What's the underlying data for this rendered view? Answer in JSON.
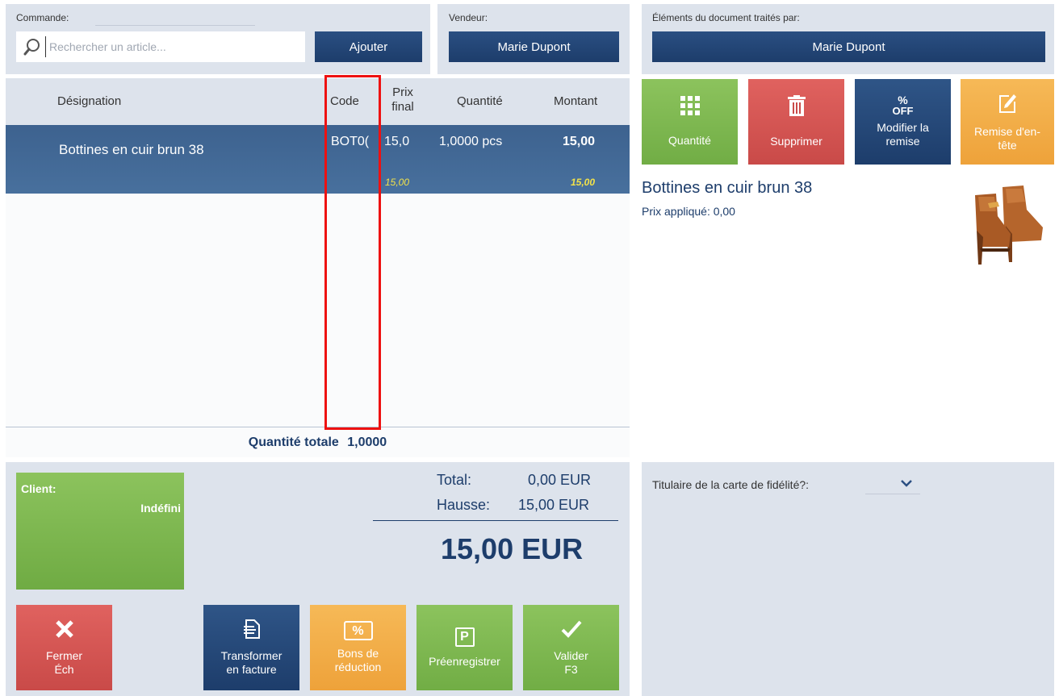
{
  "order": {
    "label": "Commande:",
    "search_placeholder": "Rechercher un article...",
    "add_label": "Ajouter"
  },
  "seller": {
    "label": "Vendeur:",
    "name": "Marie Dupont"
  },
  "processed_by": {
    "label": "Éléments du document traités par:",
    "name": "Marie Dupont"
  },
  "grid": {
    "columns": {
      "designation": "Désignation",
      "code": "Code",
      "price_line1": "Prix",
      "price_line2": "final",
      "quantity": "Quantité",
      "amount": "Montant"
    },
    "rows": [
      {
        "designation": "Bottines en cuir brun 38",
        "code": "BOT0(",
        "price": "15,0",
        "quantity": "1,0000 pcs",
        "amount": "15,00",
        "sub_price": "15,00",
        "sub_amount": "15,00"
      }
    ],
    "total_quantity_label": "Quantité totale",
    "total_quantity_value": "1,0000"
  },
  "actions": {
    "quantity": "Quantité",
    "delete": "Supprimer",
    "discount_icon_pct": "%",
    "discount_icon_off": "OFF",
    "discount_line1": "Modifier la",
    "discount_line2": "remise",
    "header_discount_line1": "Remise d'en-",
    "header_discount_line2": "tête"
  },
  "product": {
    "name": "Bottines en cuir brun 38",
    "price_label": "Prix appliqué: 0,00"
  },
  "client": {
    "label": "Client:",
    "value": "Indéfini"
  },
  "totals": {
    "total_label": "Total:",
    "total_value": "0,00 EUR",
    "surcharge_label": "Hausse:",
    "surcharge_value": "15,00 EUR",
    "grand_total": "15,00 EUR"
  },
  "loyalty": {
    "label": "Titulaire de la carte de fidélité?:"
  },
  "bottom_buttons": {
    "close_line1": "Fermer",
    "close_line2": "Éch",
    "invoice_line1": "Transformer",
    "invoice_line2": "en facture",
    "vouchers_line1": "Bons de",
    "vouchers_line2": "réduction",
    "vouchers_icon": "%",
    "preregister": "Préenregistrer",
    "preregister_icon": "P",
    "validate_line1": "Valider",
    "validate_line2": "F3"
  },
  "colors": {
    "navy": "#1d3d6b",
    "green": "#7fb94f",
    "red": "#d95552",
    "orange": "#f2ad47",
    "panel": "#dde3ec",
    "selected_row": "#41678f",
    "highlight": "#e11111"
  }
}
